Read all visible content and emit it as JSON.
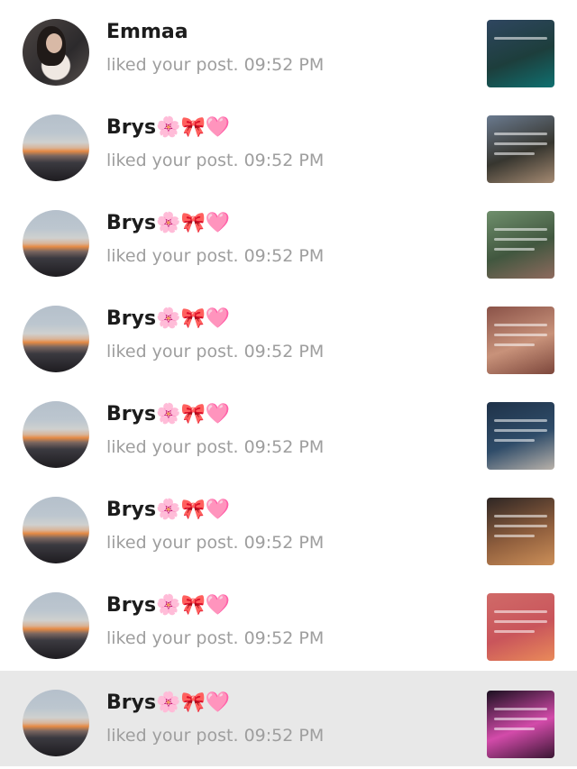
{
  "notifications": [
    {
      "name": "Emmaa",
      "action": "liked your post.",
      "time": "09:52 PM",
      "avatar_icon": "person-avatar",
      "thumb_colors": [
        "#2f4660",
        "#1d3e3c",
        "#0f7070"
      ],
      "highlighted": false
    },
    {
      "name": "Brys🌸🎀🩷",
      "action": "liked your post.",
      "time": "09:52 PM",
      "avatar_icon": "sunset-avatar",
      "thumb_colors": [
        "#6a7a8f",
        "#37362f",
        "#a58a72"
      ],
      "highlighted": false
    },
    {
      "name": "Brys🌸🎀🩷",
      "action": "liked your post.",
      "time": "09:52 PM",
      "avatar_icon": "sunset-avatar",
      "thumb_colors": [
        "#6f8f6c",
        "#41573f",
        "#8e6a5e"
      ],
      "highlighted": false
    },
    {
      "name": "Brys🌸🎀🩷",
      "action": "liked your post.",
      "time": "09:52 PM",
      "avatar_icon": "sunset-avatar",
      "thumb_colors": [
        "#8a5248",
        "#c8927a",
        "#7c463b"
      ],
      "highlighted": false
    },
    {
      "name": "Brys🌸🎀🩷",
      "action": "liked your post.",
      "time": "09:52 PM",
      "avatar_icon": "sunset-avatar",
      "thumb_colors": [
        "#1f3249",
        "#2f4c69",
        "#b9b2aa"
      ],
      "highlighted": false
    },
    {
      "name": "Brys🌸🎀🩷",
      "action": "liked your post.",
      "time": "09:52 PM",
      "avatar_icon": "sunset-avatar",
      "thumb_colors": [
        "#2e2624",
        "#8f5e3d",
        "#cc8f58"
      ],
      "highlighted": false
    },
    {
      "name": "Brys🌸🎀🩷",
      "action": "liked your post.",
      "time": "09:52 PM",
      "avatar_icon": "sunset-avatar",
      "thumb_colors": [
        "#d06a68",
        "#c9555b",
        "#e98a5a"
      ],
      "highlighted": false
    },
    {
      "name": "Brys🌸🎀🩷",
      "action": "liked your post.",
      "time": "09:52 PM",
      "avatar_icon": "sunset-avatar",
      "thumb_colors": [
        "#1b0f20",
        "#d34baa",
        "#3a1633"
      ],
      "highlighted": true
    }
  ]
}
